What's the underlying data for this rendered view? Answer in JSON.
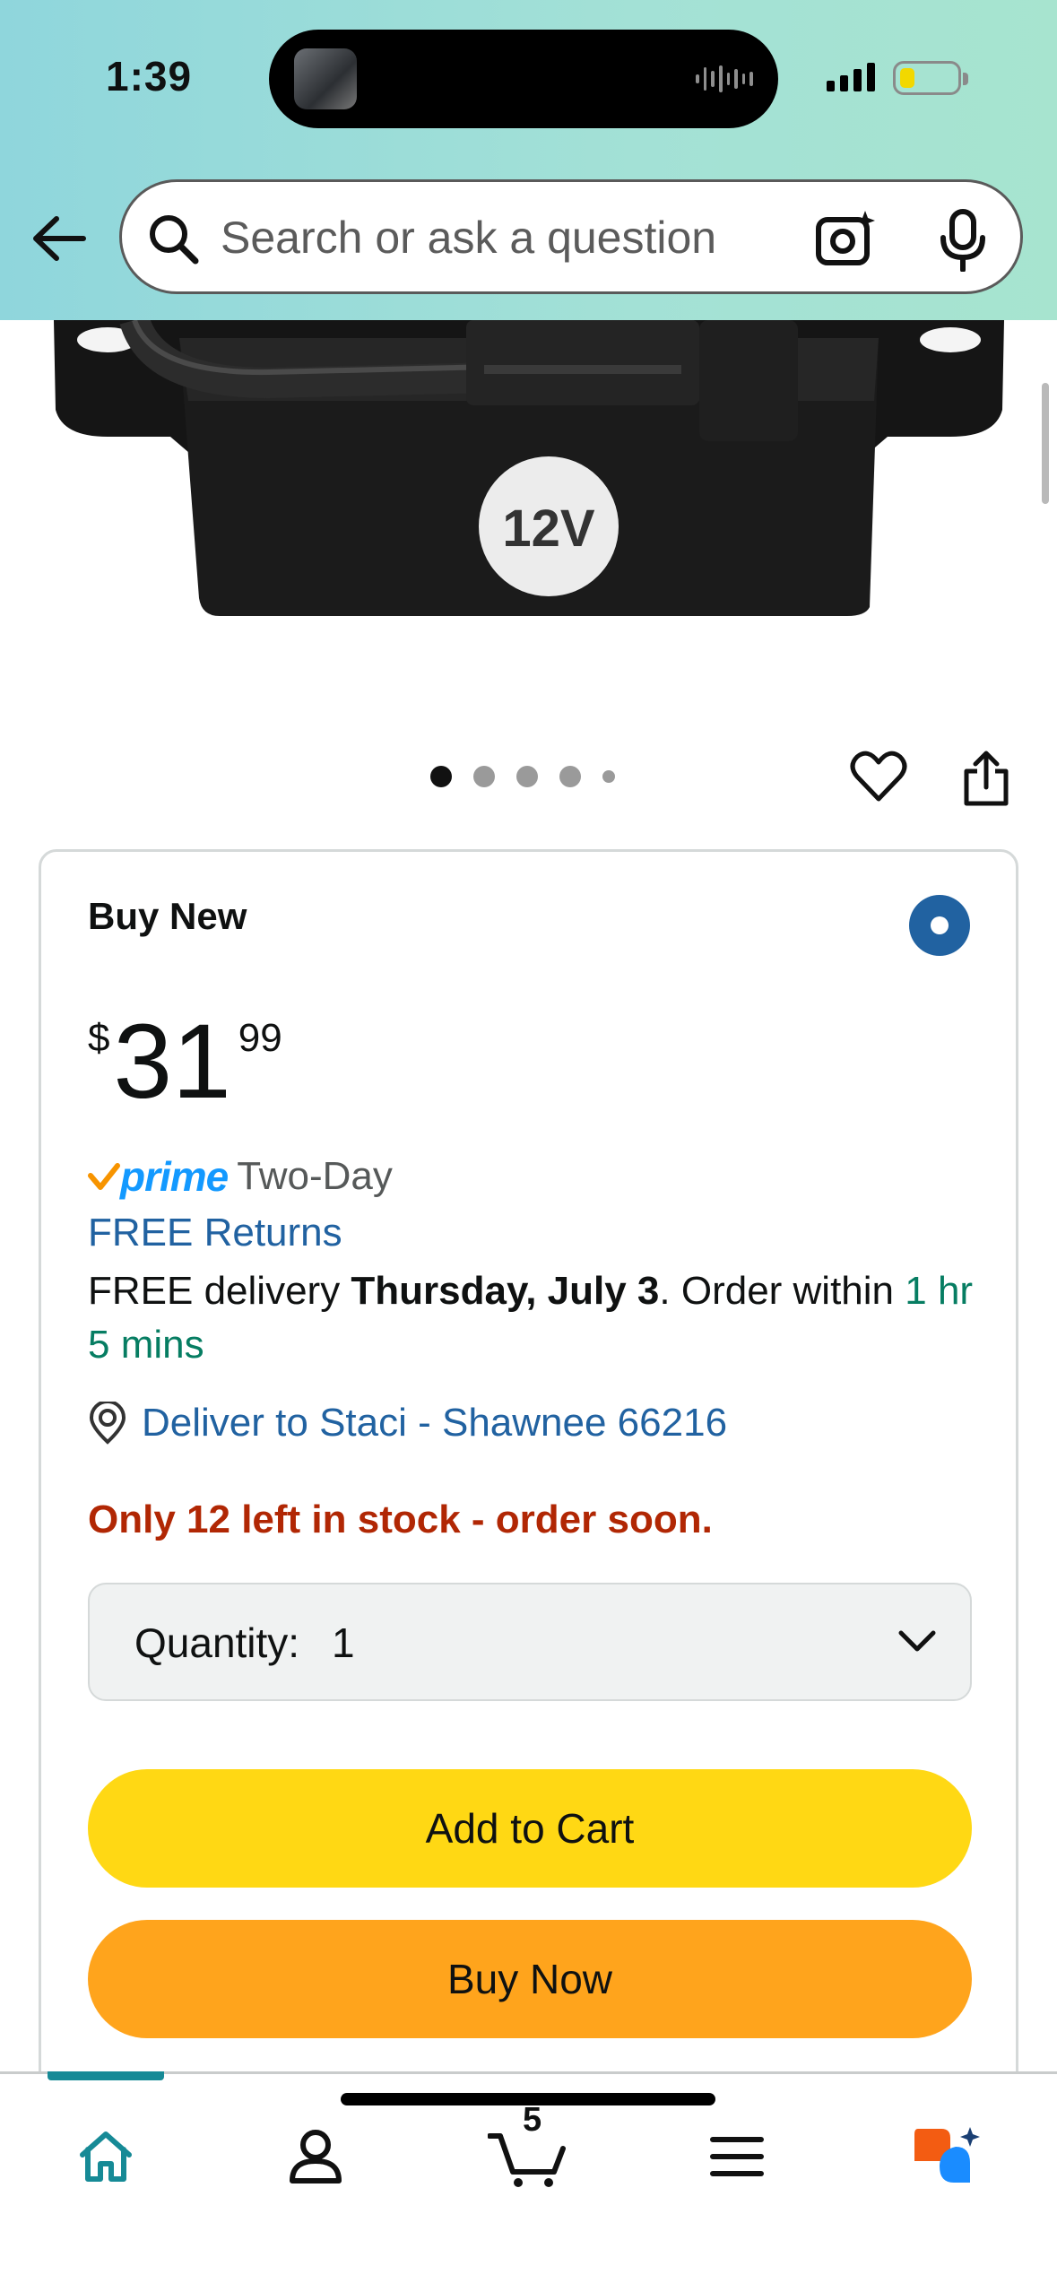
{
  "status_bar": {
    "time": "1:39"
  },
  "search": {
    "placeholder": "Search or ask a question"
  },
  "product_image": {
    "badge": "12V"
  },
  "gallery": {
    "total_images": 5,
    "active_index": 0
  },
  "buy_box": {
    "title": "Buy New",
    "price": {
      "symbol": "$",
      "whole": "31",
      "fraction": "99"
    },
    "prime_label": "prime",
    "shipping_speed": "Two-Day",
    "returns": "FREE Returns",
    "delivery_prefix": "FREE delivery ",
    "delivery_date": "Thursday, July 3",
    "delivery_mid": ". Order within ",
    "order_within": "1 hr 5 mins",
    "deliver_to": "Deliver to Staci - Shawnee 66216",
    "stock": "Only 12 left in stock - order soon.",
    "quantity_label": "Quantity:",
    "quantity_value": "1",
    "add_to_cart": "Add to Cart",
    "buy_now": "Buy Now"
  },
  "bottom_nav": {
    "items": [
      "home-icon",
      "account-icon",
      "cart-icon",
      "menu-icon",
      "rufus-icon"
    ],
    "cart_count": "5",
    "active": "home"
  },
  "colors": {
    "link_blue": "#2162a1",
    "prime_blue": "#1399ff",
    "stock_red": "#b12704",
    "green": "#067d62",
    "add_to_cart_yellow": "#ffd814",
    "buy_now_orange": "#ffa41c",
    "nav_teal": "#168a96"
  }
}
